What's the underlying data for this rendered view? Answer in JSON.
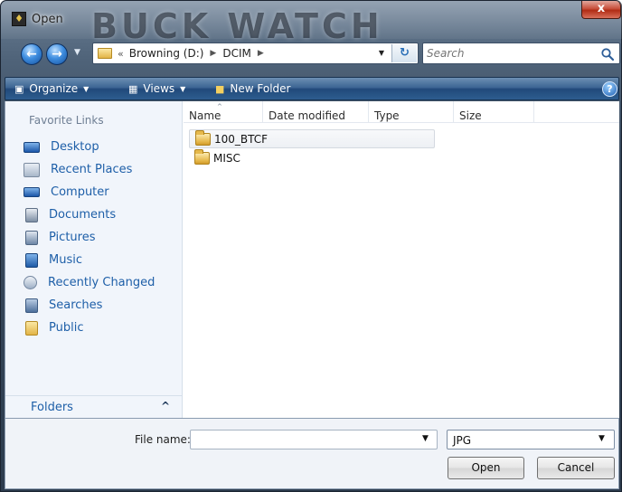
{
  "window": {
    "title": "Open",
    "wallpaper_text": "BUCK WATCH",
    "close_glyph": "x"
  },
  "navigation": {
    "back_glyph": "←",
    "forward_glyph": "→",
    "history_glyph": "▼",
    "breadcrumb_overflow": "«",
    "breadcrumb": [
      "Browning (D:)",
      "DCIM"
    ],
    "breadcrumb_separator": "▶",
    "address_dropdown_glyph": "▼",
    "refresh_glyph": "↻"
  },
  "search": {
    "placeholder": "Search"
  },
  "toolbar": {
    "organize_label": "Organize",
    "views_label": "Views",
    "new_folder_label": "New Folder",
    "dropdown_glyph": "▼",
    "help_glyph": "?"
  },
  "nav_pane": {
    "title": "Favorite Links",
    "items": [
      {
        "label": "Desktop",
        "icon": "desktop-icon"
      },
      {
        "label": "Recent Places",
        "icon": "recent-places-icon"
      },
      {
        "label": "Computer",
        "icon": "computer-icon"
      },
      {
        "label": "Documents",
        "icon": "documents-icon"
      },
      {
        "label": "Pictures",
        "icon": "pictures-icon"
      },
      {
        "label": "Music",
        "icon": "music-icon"
      },
      {
        "label": "Recently Changed",
        "icon": "recently-changed-icon"
      },
      {
        "label": "Searches",
        "icon": "searches-icon"
      },
      {
        "label": "Public",
        "icon": "public-folder-icon"
      }
    ],
    "folders_label": "Folders",
    "folders_chevron": "^"
  },
  "file_list": {
    "columns": [
      "Name",
      "Date modified",
      "Type",
      "Size"
    ],
    "sort_indicator": "^",
    "rows": [
      {
        "name": "100_BTCF",
        "selected": true
      },
      {
        "name": "MISC",
        "selected": false
      }
    ]
  },
  "footer": {
    "file_name_label": "File name:",
    "file_name_value": "",
    "file_name_dropdown_glyph": "▼",
    "file_type_value": "JPG",
    "file_type_dropdown_glyph": "▼",
    "open_label": "Open",
    "cancel_label": "Cancel"
  },
  "colors": {
    "link_blue": "#1e5fa8",
    "command_bar": "#2d5d8f",
    "nav_pane_bg": "#f1f5fb"
  }
}
